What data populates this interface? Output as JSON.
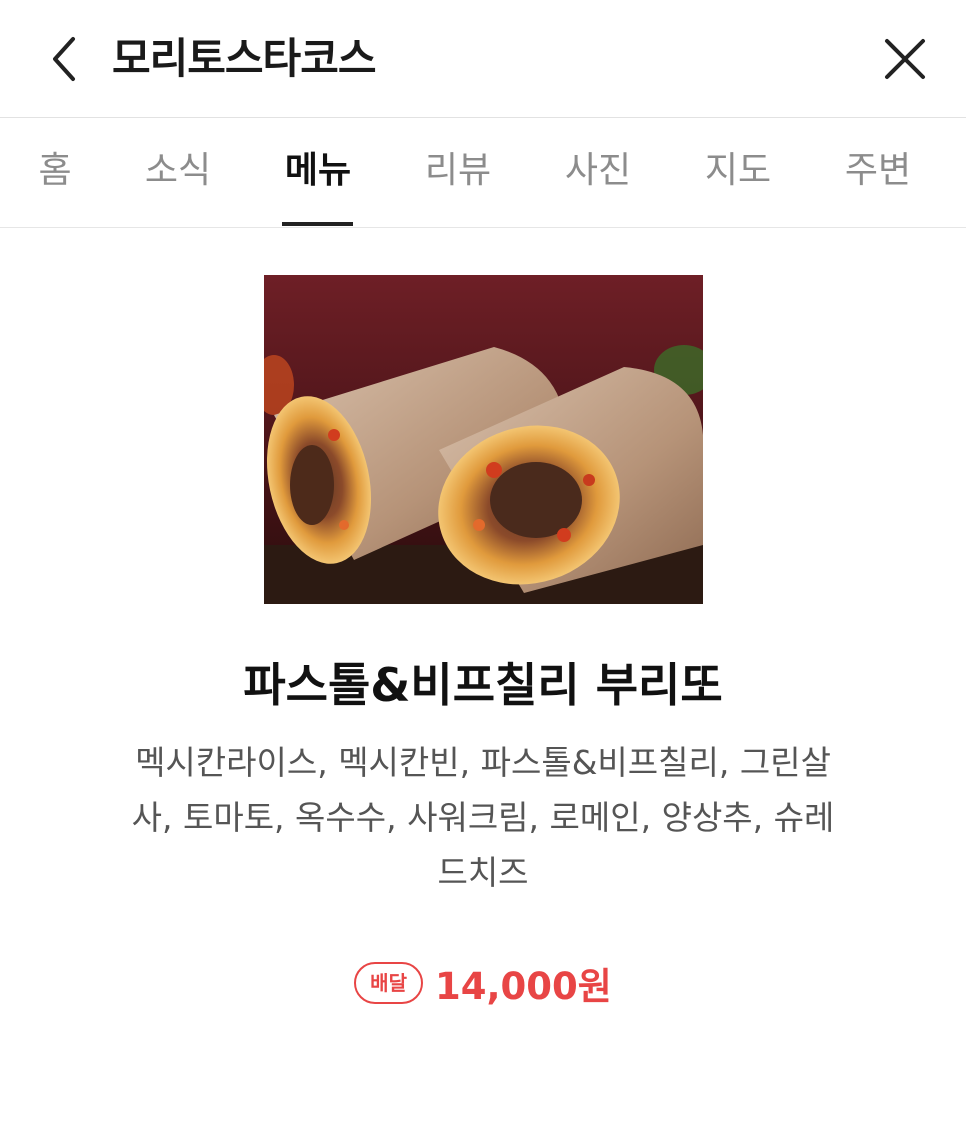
{
  "header": {
    "title": "모리토스타코스",
    "back_icon": "chevron-left-icon",
    "close_icon": "close-icon"
  },
  "tabs": [
    {
      "label": "홈",
      "active": false
    },
    {
      "label": "소식",
      "active": false
    },
    {
      "label": "메뉴",
      "active": true
    },
    {
      "label": "리뷰",
      "active": false
    },
    {
      "label": "사진",
      "active": false
    },
    {
      "label": "지도",
      "active": false
    },
    {
      "label": "주변",
      "active": false
    }
  ],
  "menu_item": {
    "photo_icon": "burrito-photo",
    "name": "파스톨&비프칠리 부리또",
    "description": "멕시칸라이스, 멕시칸빈, 파스톨&비프칠리, 그린살사, 토마토, 옥수수, 사워크림, 로메인, 양상추, 슈레드치즈",
    "badge": "배달",
    "price": "14,000원"
  },
  "colors": {
    "accent": "#e84545",
    "active_tab": "#111111",
    "inactive_tab": "#8c8c8c"
  }
}
